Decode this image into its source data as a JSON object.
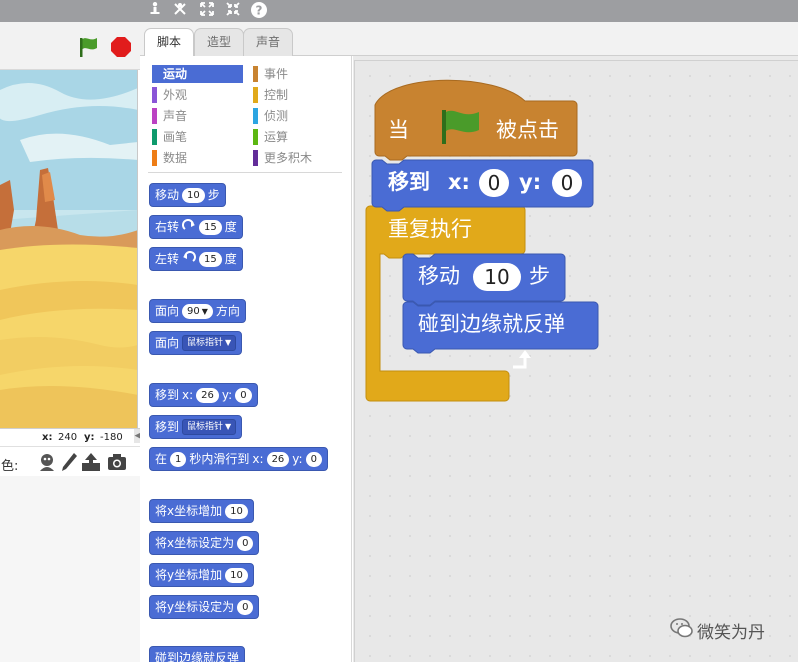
{
  "toolbar": {
    "icons": [
      "duplicate-icon",
      "cut-icon",
      "grow-icon",
      "shrink-icon",
      "help-icon"
    ],
    "help_glyph": "?"
  },
  "stage": {
    "x_label": "x:",
    "x_value": "240",
    "y_label": "y:",
    "y_value": "-180",
    "sprite_label": "角色:"
  },
  "tabs": [
    {
      "label": "脚本",
      "active": true
    },
    {
      "label": "造型",
      "active": false
    },
    {
      "label": "声音",
      "active": false
    }
  ],
  "categories": [
    {
      "label": "运动",
      "color": "#4a6cd4",
      "selected": true
    },
    {
      "label": "事件",
      "color": "#c88330",
      "selected": false
    },
    {
      "label": "外观",
      "color": "#8a55d7",
      "selected": false
    },
    {
      "label": "控制",
      "color": "#e1a91a",
      "selected": false
    },
    {
      "label": "声音",
      "color": "#bb42c3",
      "selected": false
    },
    {
      "label": "侦测",
      "color": "#2ca5e2",
      "selected": false
    },
    {
      "label": "画笔",
      "color": "#0e9a6c",
      "selected": false
    },
    {
      "label": "运算",
      "color": "#5cb712",
      "selected": false
    },
    {
      "label": "数据",
      "color": "#ee7d16",
      "selected": false
    },
    {
      "label": "更多积木",
      "color": "#632d99",
      "selected": false
    }
  ],
  "palette": {
    "move": {
      "text": "移动",
      "value": "10",
      "suffix": "步"
    },
    "turn_right": {
      "text": "右转",
      "value": "15",
      "suffix": "度"
    },
    "turn_left": {
      "text": "左转",
      "value": "15",
      "suffix": "度"
    },
    "point_dir": {
      "text": "面向",
      "value": "90",
      "suffix": "方向"
    },
    "point_towards": {
      "text": "面向",
      "value": "鼠标指针"
    },
    "goto_xy": {
      "text": "移到",
      "x_label": "x:",
      "x_value": "26",
      "y_label": "y:",
      "y_value": "0"
    },
    "goto": {
      "text": "移到",
      "value": "鼠标指针"
    },
    "glide": {
      "text": "在",
      "secs": "1",
      "mid": "秒内滑行到",
      "x_label": "x:",
      "x_value": "26",
      "y_label": "y:",
      "y_value": "0"
    },
    "change_x": {
      "text": "将x坐标增加",
      "value": "10"
    },
    "set_x": {
      "text": "将x坐标设定为",
      "value": "0"
    },
    "change_y": {
      "text": "将y坐标增加",
      "value": "10"
    },
    "set_y": {
      "text": "将y坐标设定为",
      "value": "0"
    },
    "bounce": {
      "text": "碰到边缘就反弹"
    }
  },
  "script": {
    "hat_when": "当",
    "hat_clicked": "被点击",
    "goto_text": "移到",
    "goto_x_label": "x:",
    "goto_x_value": "0",
    "goto_y_label": "y:",
    "goto_y_value": "0",
    "forever_text": "重复执行",
    "move_text": "移动",
    "move_value": "10",
    "move_suffix": "步",
    "bounce_text": "碰到边缘就反弹"
  },
  "watermark": "微笑为丹",
  "colors": {
    "motion": "#4a6cd4",
    "events": "#c88330",
    "control": "#e1a91a",
    "flag_green": "#4a9b2a",
    "stop_red": "#e11c1c"
  }
}
